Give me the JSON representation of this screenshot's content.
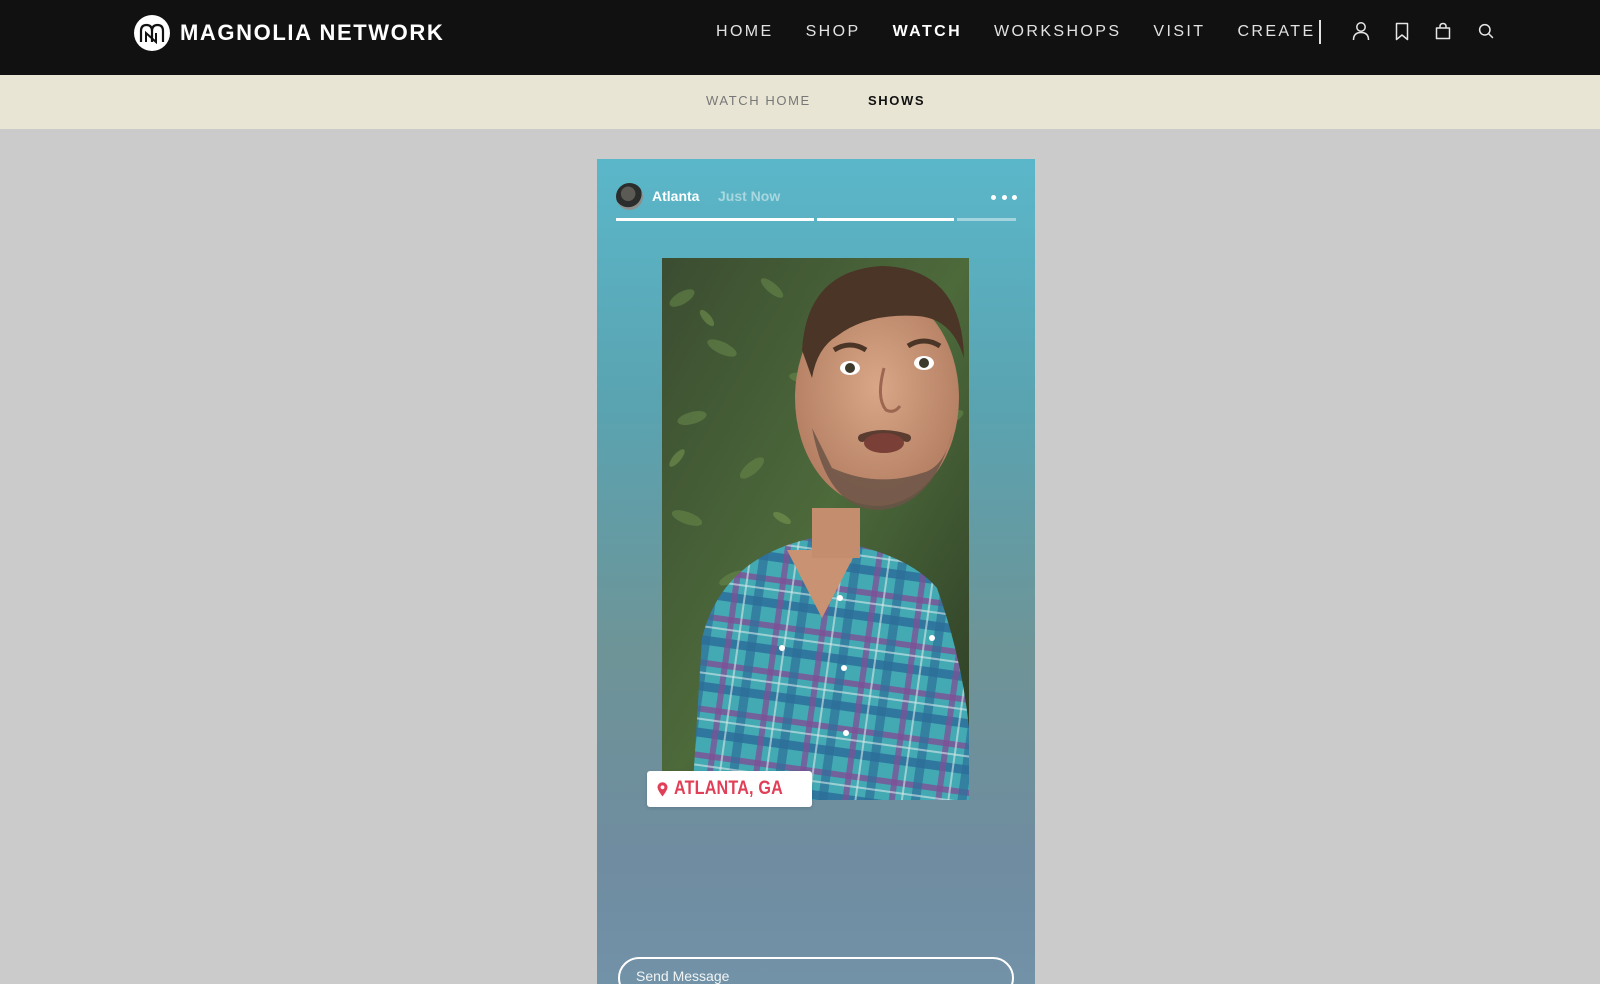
{
  "brand": {
    "name": "MAGNOLIA NETWORK"
  },
  "nav": {
    "items": [
      {
        "label": "HOME",
        "active": false
      },
      {
        "label": "SHOP",
        "active": false
      },
      {
        "label": "WATCH",
        "active": true
      },
      {
        "label": "WORKSHOPS",
        "active": false
      },
      {
        "label": "VISIT",
        "active": false
      },
      {
        "label": "CREATE",
        "active": false
      }
    ],
    "icons": [
      "account-icon",
      "bookmark-icon",
      "bag-icon",
      "search-icon"
    ]
  },
  "subnav": {
    "items": [
      {
        "label": "WATCH HOME",
        "active": false
      },
      {
        "label": "SHOWS",
        "active": true
      }
    ]
  },
  "story": {
    "user": "Atlanta",
    "time": "Just Now",
    "progress": [
      {
        "fill": 1.0
      },
      {
        "fill": 1.0
      },
      {
        "fill": 0.0
      }
    ],
    "location": "ATLANTA, GA",
    "message_placeholder": "Send Message"
  },
  "colors": {
    "topbar": "#111111",
    "subbar": "#e8e5d4",
    "page_background": "#cbcbcb",
    "story_gradient_top": "#5ab7c9",
    "story_gradient_bottom": "#7292a8",
    "location_text": "#e03f57"
  }
}
